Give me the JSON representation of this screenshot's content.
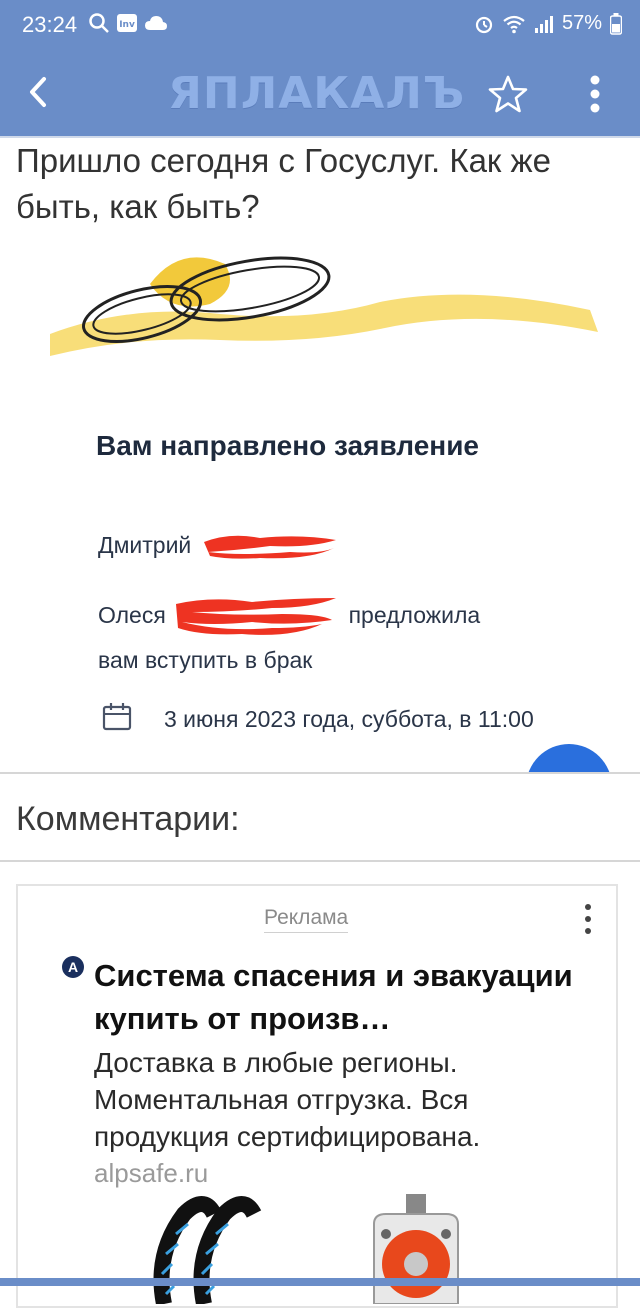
{
  "status_bar": {
    "time": "23:24",
    "battery": "57%"
  },
  "app_bar": {
    "logo_text": "ЯПЛАКАЛЪ"
  },
  "post": {
    "title": "Пришло сегодня с Госуслуг. Как же быть, как быть?",
    "image": {
      "notice_title": "Вам направлено заявление",
      "person1": "Дмитрий",
      "person2_name": "Олеся",
      "person2_action": "предложила",
      "person2_line2": "вам вступить в брак",
      "date_text": "3 июня 2023 года, суббота, в 11:00"
    }
  },
  "comments": {
    "title": "Комментарии:"
  },
  "ad": {
    "label": "Реклама",
    "badge": "A",
    "headline": "Система спасения и эвакуации купить от произв…",
    "body": "Доставка в любые регионы. Моментальная отгрузка. Вся продукция сертифицирована.",
    "domain": "alpsafe.ru"
  },
  "colors": {
    "bar": "#6a8dc8",
    "fab": "#2a6fdd",
    "redaction": "#ee3322",
    "ribbon": "#f7d861"
  }
}
